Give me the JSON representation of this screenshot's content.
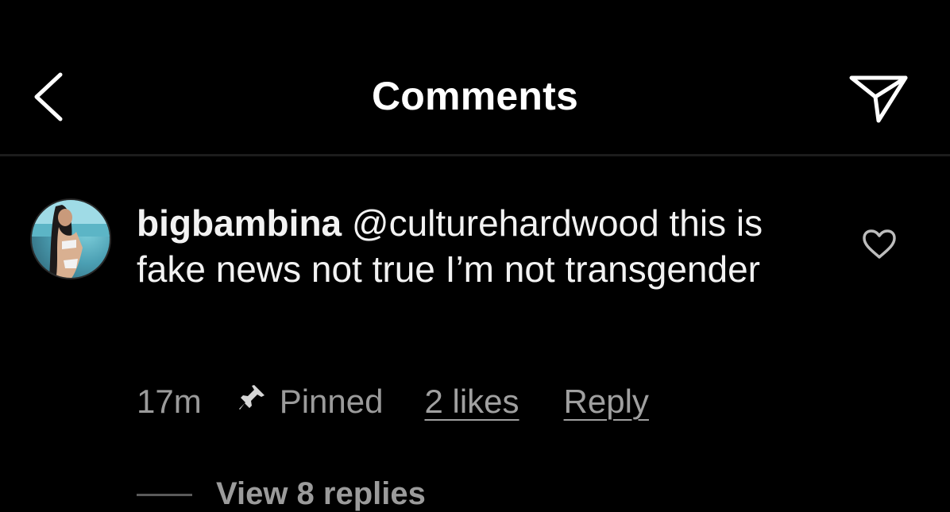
{
  "header": {
    "title": "Comments",
    "back_icon": "chevron-left-icon",
    "share_icon": "paper-plane-icon"
  },
  "comment": {
    "username": "bigbambina",
    "text": "@culturehardwood this is fake news not true I’m not transgender",
    "time": "17m",
    "pinned_label": "Pinned",
    "likes_label": "2 likes",
    "reply_label": "Reply",
    "like_icon": "heart-icon",
    "pin_icon": "pin-icon"
  },
  "replies": {
    "view_label": "View 8 replies"
  },
  "colors": {
    "background": "#000000",
    "text": "#f2f2f2",
    "secondary_text": "#9b9b9b"
  }
}
